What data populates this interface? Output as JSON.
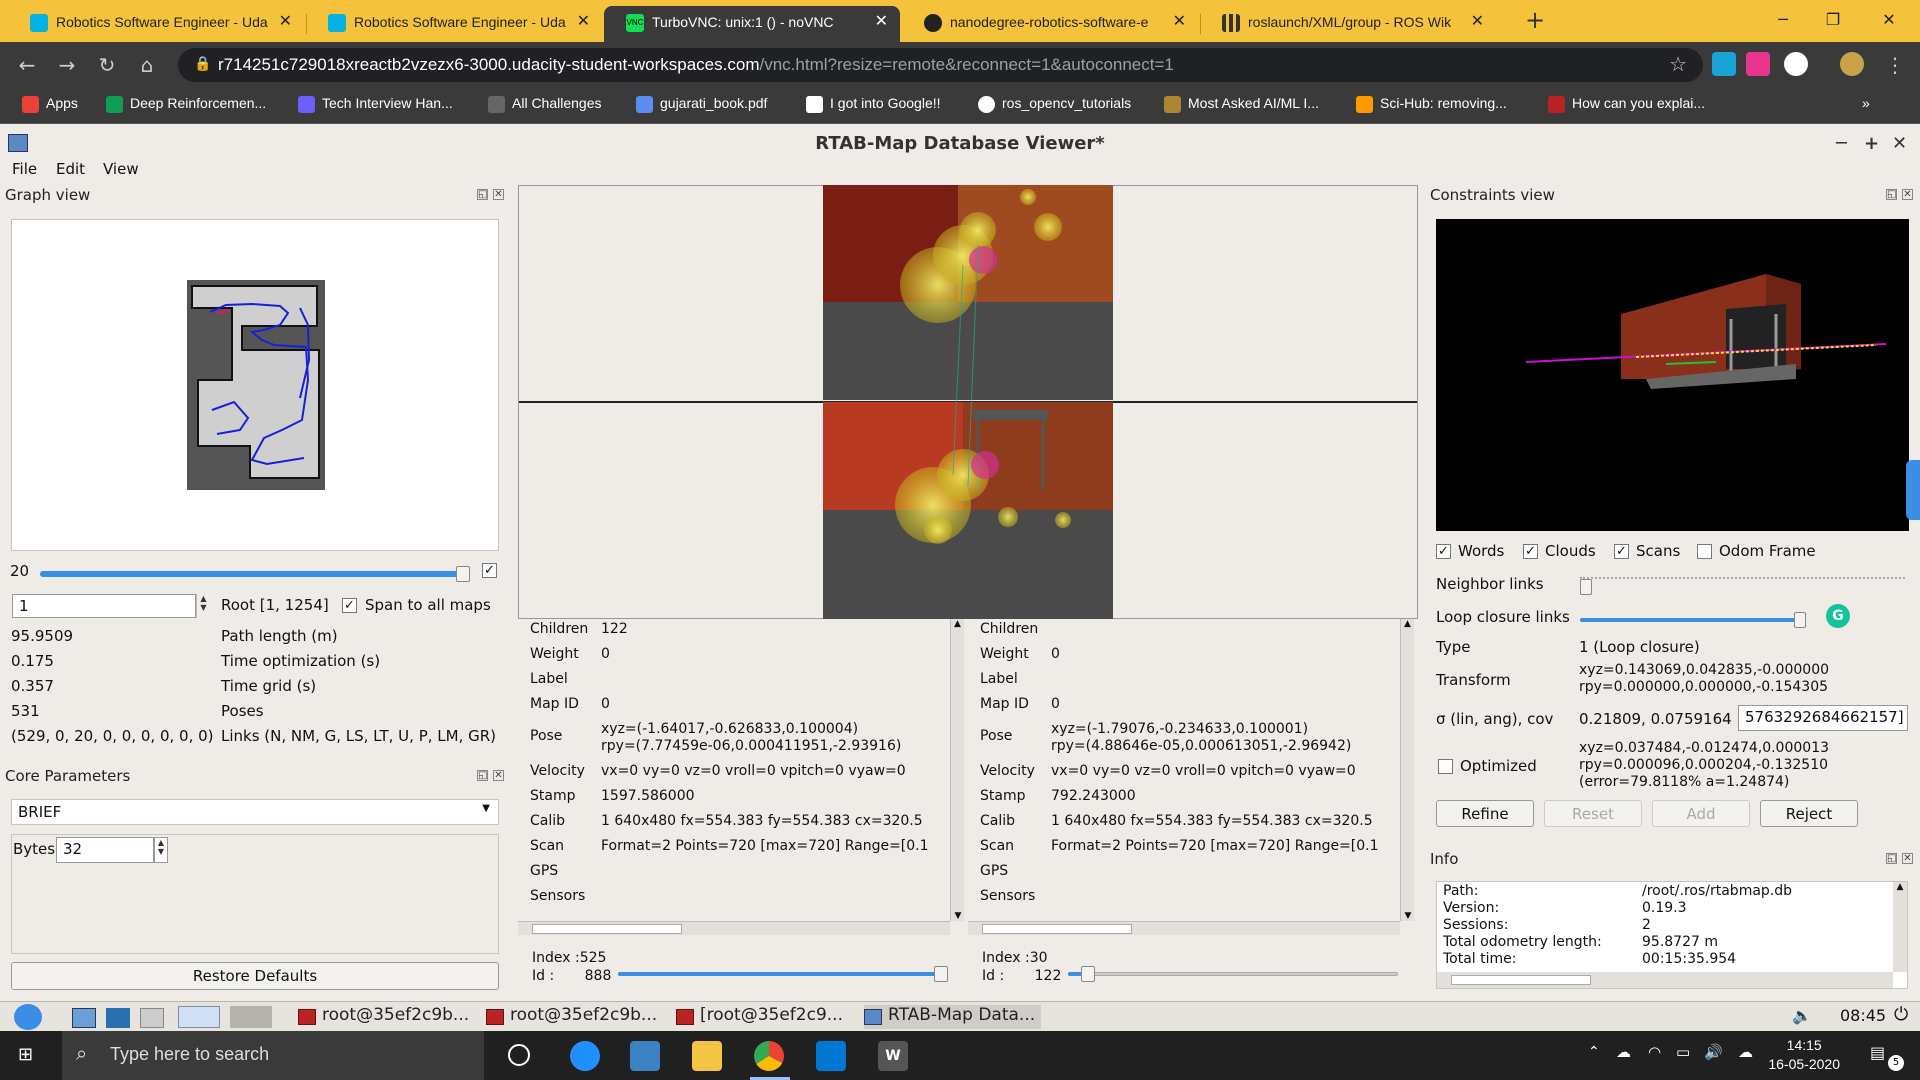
{
  "browser": {
    "tabs": [
      {
        "title": "Robotics Software Engineer - Uda",
        "color": "#02b3e4"
      },
      {
        "title": "Robotics Software Engineer - Uda",
        "color": "#02b3e4"
      },
      {
        "title": "TurboVNC: unix:1 () - noVNC",
        "color": "#2a6"
      },
      {
        "title": "nanodegree-robotics-software-e",
        "color": "#333"
      },
      {
        "title": "roslaunch/XML/group - ROS Wik",
        "color": "#333"
      }
    ],
    "url_host": "r714251c729018xreactb2vzezx6-3000.udacity-student-workspaces.com",
    "url_path": "/vnc.html?resize=remote&reconnect=1&autoconnect=1",
    "bookmarks": [
      {
        "label": "Apps",
        "color": "#ea4335"
      },
      {
        "label": "Deep Reinforcemen...",
        "color": "#0f9d58"
      },
      {
        "label": "Tech Interview Han...",
        "color": "#6d5dfc"
      },
      {
        "label": "All Challenges",
        "color": "#555"
      },
      {
        "label": "gujarati_book.pdf",
        "color": "#5b8def"
      },
      {
        "label": "I got into Google!!",
        "color": "#fff"
      },
      {
        "label": "ros_opencv_tutorials",
        "color": "#fff"
      },
      {
        "label": "Most Asked AI/ML I...",
        "color": "#a83"
      },
      {
        "label": "Sci-Hub: removing...",
        "color": "#f90"
      },
      {
        "label": "How can you explai...",
        "color": "#b22"
      }
    ],
    "more": "»"
  },
  "app": {
    "title": "RTAB-Map Database Viewer*",
    "menu": [
      "File",
      "Edit",
      "View"
    ]
  },
  "graph_view": {
    "title": "Graph view",
    "slider_value": "20",
    "node_id": "1",
    "root": "Root [1, 1254]",
    "span_label": "Span to all maps",
    "stats": [
      {
        "value": "95.9509",
        "label": "Path length (m)"
      },
      {
        "value": "0.175",
        "label": "Time optimization (s)"
      },
      {
        "value": "0.357",
        "label": "Time grid (s)"
      },
      {
        "value": "531",
        "label": "Poses"
      },
      {
        "value": "(529, 0, 20, 0, 0, 0, 0, 0, 0)",
        "label": "Links (N, NM, G, LS, LT, U, P, LM, GR)"
      }
    ]
  },
  "core_params": {
    "title": "Core Parameters",
    "descriptor": "BRIEF",
    "bytes_label": "Bytes",
    "bytes_value": "32",
    "restore": "Restore Defaults"
  },
  "node_left": {
    "rows": [
      {
        "k": "Children",
        "v": "122"
      },
      {
        "k": "Weight",
        "v": "0"
      },
      {
        "k": "Label",
        "v": ""
      },
      {
        "k": "Map ID",
        "v": "0"
      },
      {
        "k": "Pose",
        "v": "xyz=(-1.64017,-0.626833,0.100004)",
        "v2": "rpy=(7.77459e-06,0.000411951,-2.93916)"
      },
      {
        "k": "Velocity",
        "v": "vx=0 vy=0 vz=0 vroll=0 vpitch=0 vyaw=0"
      },
      {
        "k": "Stamp",
        "v": "1597.586000"
      },
      {
        "k": "Calib",
        "v": "1 640x480 fx=554.383 fy=554.383 cx=320.5"
      },
      {
        "k": "Scan",
        "v": "Format=2 Points=720 [max=720] Range=[0.1"
      },
      {
        "k": "GPS",
        "v": ""
      },
      {
        "k": "Sensors",
        "v": ""
      }
    ],
    "index_label": "Index :",
    "index": "525",
    "id_label": "Id :",
    "id": "888",
    "slider_fraction": 0.98
  },
  "node_right": {
    "rows": [
      {
        "k": "Children",
        "v": ""
      },
      {
        "k": "Weight",
        "v": "0"
      },
      {
        "k": "Label",
        "v": ""
      },
      {
        "k": "Map ID",
        "v": "0"
      },
      {
        "k": "Pose",
        "v": "xyz=(-1.79076,-0.234633,0.100001)",
        "v2": "rpy=(4.88646e-05,0.000613051,-2.96942)"
      },
      {
        "k": "Velocity",
        "v": "vx=0 vy=0 vz=0 vroll=0 vpitch=0 vyaw=0"
      },
      {
        "k": "Stamp",
        "v": "792.243000"
      },
      {
        "k": "Calib",
        "v": "1 640x480 fx=554.383 fy=554.383 cx=320.5"
      },
      {
        "k": "Scan",
        "v": "Format=2 Points=720 [max=720] Range=[0.1"
      },
      {
        "k": "GPS",
        "v": ""
      },
      {
        "k": "Sensors",
        "v": ""
      }
    ],
    "index_label": "Index :",
    "index": "30",
    "id_label": "Id :",
    "id": "122",
    "slider_fraction": 0.06
  },
  "constraints": {
    "title": "Constraints view",
    "checks": [
      {
        "label": "Words",
        "checked": true
      },
      {
        "label": "Clouds",
        "checked": true
      },
      {
        "label": "Scans",
        "checked": true
      },
      {
        "label": "Odom Frame",
        "checked": false
      }
    ],
    "neighbor_label": "Neighbor links",
    "loop_label": "Loop closure links",
    "type_label": "Type",
    "type_value": "1  (Loop closure)",
    "transform_label": "Transform",
    "transform_xyz": "xyz=0.143069,0.042835,-0.000000",
    "transform_rpy": "rpy=0.000000,0.000000,-0.154305",
    "sigma_label": "σ (lin, ang), cov",
    "sigma_value": "0.21809, 0.0759164",
    "cov_value": "5763292684662157]",
    "optimized_label": "Optimized",
    "opt_xyz": "xyz=0.037484,-0.012474,0.000013",
    "opt_rpy": "rpy=0.000096,0.000204,-0.132510",
    "opt_err": "(error=79.8118% a=1.24874)",
    "buttons": [
      "Refine",
      "Reset",
      "Add",
      "Reject"
    ]
  },
  "info": {
    "title": "Info",
    "rows": [
      {
        "k": "Path:",
        "v": "/root/.ros/rtabmap.db"
      },
      {
        "k": "Version:",
        "v": "0.19.3"
      },
      {
        "k": "Sessions:",
        "v": "2"
      },
      {
        "k": "Total odometry length:",
        "v": "95.8727 m"
      },
      {
        "k": "Total time:",
        "v": "00:15:35.954"
      }
    ]
  },
  "vnc_taskbar": {
    "tasks": [
      "root@35ef2c9b...",
      "root@35ef2c9b...",
      "[root@35ef2c9...",
      "RTAB-Map Data..."
    ],
    "time": "08:45"
  },
  "win_taskbar": {
    "search_placeholder": "Type here to search",
    "time": "14:15",
    "date": "16-05-2020",
    "notif_count": "5"
  }
}
